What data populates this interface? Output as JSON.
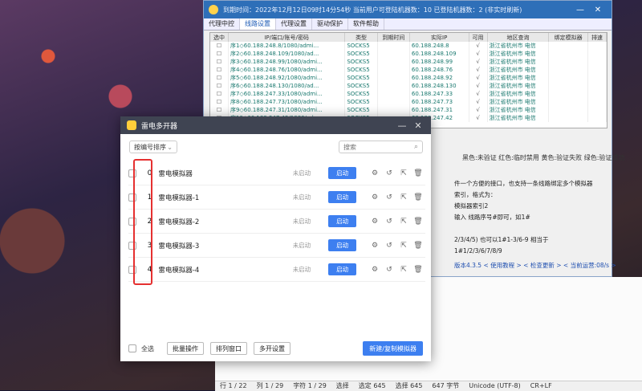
{
  "proxy_window": {
    "title": "到期时间：2022年12月12日09时14分54秒  当前用户可登陆机器数：10  已登陆机器数：2 (非实时刷新)",
    "tabs": [
      "代理中控",
      "线路设置",
      "代理设置",
      "驱动保护",
      "软件帮助"
    ],
    "active_tab": "线路设置",
    "columns": [
      "选中",
      "IP/端口/账号/密码",
      "类型",
      "到期时间",
      "实际IP",
      "可用",
      "地区查询",
      "绑定模拟器",
      "排速"
    ],
    "rows": [
      {
        "ip": "序1◇60.188.248.8/1080/admi...",
        "type": "SOCKS5",
        "real_ip": "60.188.248.8",
        "ok": "√",
        "region": "浙江省杭州市  电信"
      },
      {
        "ip": "序2◇60.188.248.109/1080/ad...",
        "type": "SOCKS5",
        "real_ip": "60.188.248.109",
        "ok": "√",
        "region": "浙江省杭州市  电信"
      },
      {
        "ip": "序3◇60.188.248.99/1080/admi...",
        "type": "SOCKS5",
        "real_ip": "60.188.248.99",
        "ok": "√",
        "region": "浙江省杭州市  电信"
      },
      {
        "ip": "序4◇60.188.248.76/1080/admi...",
        "type": "SOCKS5",
        "real_ip": "60.188.248.76",
        "ok": "√",
        "region": "浙江省杭州市  电信"
      },
      {
        "ip": "序5◇60.188.248.92/1080/admi...",
        "type": "SOCKS5",
        "real_ip": "60.188.248.92",
        "ok": "√",
        "region": "浙江省杭州市  电信"
      },
      {
        "ip": "序6◇60.188.248.130/1080/ad...",
        "type": "SOCKS5",
        "real_ip": "60.188.248.130",
        "ok": "√",
        "region": "浙江省杭州市  电信"
      },
      {
        "ip": "序7◇60.188.247.33/1080/admi...",
        "type": "SOCKS5",
        "real_ip": "60.188.247.33",
        "ok": "√",
        "region": "浙江省杭州市  电信"
      },
      {
        "ip": "序8◇60.188.247.73/1080/admi...",
        "type": "SOCKS5",
        "real_ip": "60.188.247.73",
        "ok": "√",
        "region": "浙江省杭州市  电信"
      },
      {
        "ip": "序9◇60.188.247.31/1080/admi...",
        "type": "SOCKS5",
        "real_ip": "60.188.247.31",
        "ok": "√",
        "region": "浙江省杭州市  电信"
      },
      {
        "ip": "序10◇60.188.247.42/1080/ad...",
        "type": "SOCKS5",
        "real_ip": "60.188.247.42",
        "ok": "√",
        "region": "浙江省杭州市  电信"
      }
    ],
    "legend": "黑色:未验证 红色:临时禁用 黄色:验证失败 绿色:验证成功",
    "note": "件一个方便的接口，也支持一条线路绑定多个模拟器索引，格式为：\n模拟器索引2\n输入 线路序号#即可，如1#\n\n2/3/4/5) 也可以1#1-3/6-9 相当于1#1/2/3/6/7/8/9",
    "footer": "版本4.3.5   < 使用教程 >   < 检查更新 >   < 当前运营:08/s >"
  },
  "statusbar": [
    "行 1 / 22",
    "列 1 / 29",
    "字符 1 / 29",
    "选择",
    "选定 645",
    "选择 645",
    "647 字节",
    "Unicode (UTF-8)",
    "CR+LF"
  ],
  "manager": {
    "title": "雷电多开器",
    "sort_label": "按编号排序",
    "search_placeholder": "搜索",
    "instances": [
      {
        "index": "0",
        "name": "雷电模拟器",
        "state": "未启动",
        "start": "启动"
      },
      {
        "index": "1",
        "name": "雷电模拟器-1",
        "state": "未启动",
        "start": "启动"
      },
      {
        "index": "2",
        "name": "雷电模拟器-2",
        "state": "未启动",
        "start": "启动"
      },
      {
        "index": "3",
        "name": "雷电模拟器-3",
        "state": "未启动",
        "start": "启动"
      },
      {
        "index": "4",
        "name": "雷电模拟器-4",
        "state": "未启动",
        "start": "启动"
      }
    ],
    "select_all": "全选",
    "batch": "批量操作",
    "arrange": "排列窗口",
    "multi_settings": "多开设置",
    "new_copy": "新建/复制模拟器"
  },
  "colors": {
    "accent": "#3d7ff0",
    "highlight": "#e53030",
    "proxy_title": "#2e6fb8"
  }
}
